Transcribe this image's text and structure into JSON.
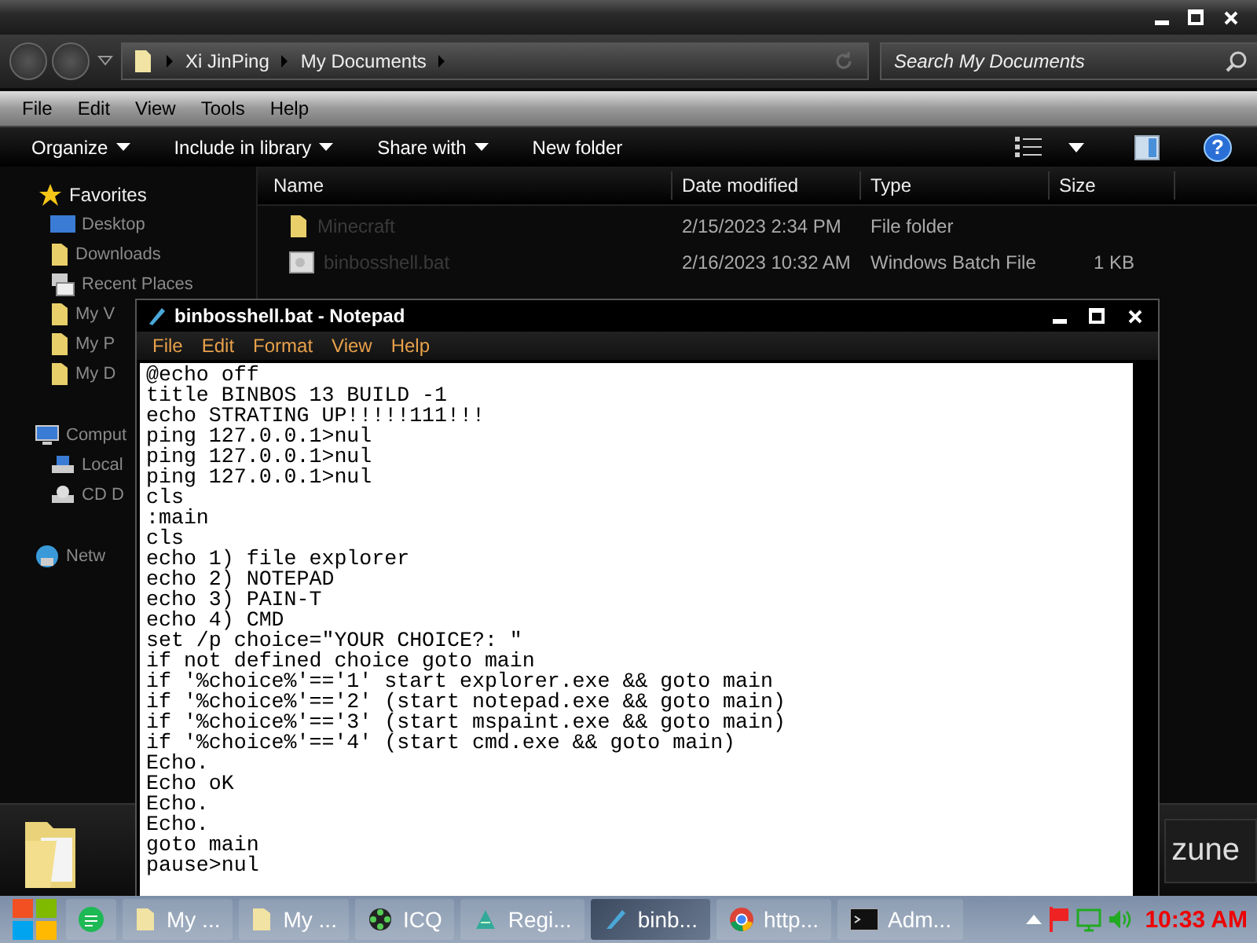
{
  "explorer": {
    "breadcrumb": [
      "Xi JinPing",
      "My Documents"
    ],
    "search": {
      "placeholder": "Search My Documents"
    },
    "menu": [
      "File",
      "Edit",
      "View",
      "Tools",
      "Help"
    ],
    "commands": [
      {
        "label": "Organize",
        "dropdown": true
      },
      {
        "label": "Include in library",
        "dropdown": true
      },
      {
        "label": "Share with",
        "dropdown": true
      },
      {
        "label": "New folder",
        "dropdown": false
      }
    ],
    "sidebar": {
      "groups": [
        {
          "label": "Favorites",
          "kind": "star",
          "children": [
            {
              "label": "Desktop",
              "kind": "monitor"
            },
            {
              "label": "Downloads",
              "kind": "folder"
            },
            {
              "label": "Recent Places",
              "kind": "recent"
            },
            {
              "label": "My V",
              "kind": "folder"
            },
            {
              "label": "My P",
              "kind": "folder"
            },
            {
              "label": "My D",
              "kind": "folder"
            }
          ]
        },
        {
          "label": "Comput",
          "kind": "computer",
          "children": [
            {
              "label": "Local",
              "kind": "disk"
            },
            {
              "label": "CD D",
              "kind": "cd"
            }
          ]
        },
        {
          "label": "Netw",
          "kind": "network"
        }
      ]
    },
    "columns": [
      "Name",
      "Date modified",
      "Type",
      "Size"
    ],
    "rows": [
      {
        "kind": "folder",
        "name": "Minecraft",
        "date": "2/15/2023 2:34 PM",
        "type": "File folder"
      },
      {
        "kind": "file",
        "name": "binbosshell.bat",
        "date": "2/16/2023 10:32 AM",
        "type": "Windows Batch File",
        "size": "1 KB"
      }
    ],
    "logo": "zune",
    "help_icon": "?"
  },
  "notepad": {
    "title": "binbosshell.bat - Notepad",
    "menu": [
      "File",
      "Edit",
      "Format",
      "View",
      "Help"
    ],
    "lines": [
      "@echo off",
      "title BINBOS 13 BUILD -1",
      "echo STRATING UP!!!!!111!!!",
      "ping 127.0.0.1>nul",
      "ping 127.0.0.1>nul",
      "ping 127.0.0.1>nul",
      "cls",
      ":main",
      "cls",
      "echo 1) file explorer",
      "echo 2) NOTEPAD",
      "echo 3) PAIN-T",
      "echo 4) CMD",
      "set /p choice=\"YOUR CHOICE?: \"",
      "if not defined choice goto main",
      "if '%choice%'=='1' start explorer.exe && goto main",
      "if '%choice%'=='2' (start notepad.exe && goto main)",
      "if '%choice%'=='3' (start mspaint.exe && goto main)",
      "if '%choice%'=='4' (start cmd.exe && goto main)",
      "Echo.",
      "Echo oK",
      "Echo.",
      "Echo.",
      "goto main",
      "pause>nul"
    ]
  },
  "taskbar": {
    "items": [
      {
        "kind": "sheet",
        "selected": false
      },
      {
        "kind": "folder",
        "label": "My ...",
        "selected": false
      },
      {
        "kind": "folder",
        "label": "My ...",
        "selected": false
      },
      {
        "kind": "flower",
        "label": "ICQ",
        "selected": false
      },
      {
        "kind": "regedit",
        "label": "Regi...",
        "selected": false
      },
      {
        "kind": "notepad",
        "label": "binb...",
        "selected": true
      },
      {
        "kind": "chrome",
        "label": "http...",
        "selected": false
      },
      {
        "kind": "cmd",
        "label": "Adm...",
        "selected": false
      }
    ],
    "clock": "10:33 AM"
  }
}
